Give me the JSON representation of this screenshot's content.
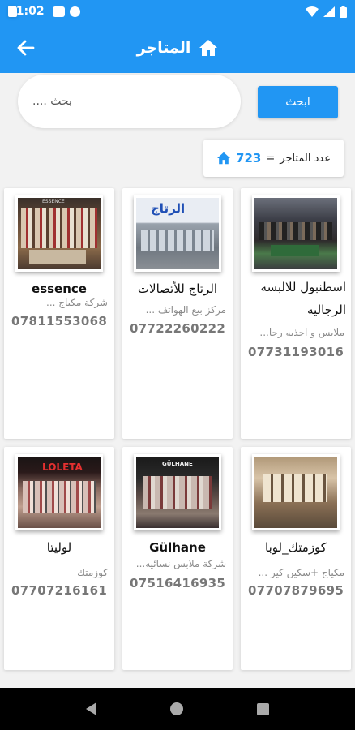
{
  "status_bar": {
    "time": "11:02"
  },
  "app_bar": {
    "title": "المتاجر"
  },
  "search": {
    "placeholder": "بحث ....",
    "button_label": "ابحث"
  },
  "store_count": {
    "label": "عدد المتاجر",
    "equals": "=",
    "value": "723"
  },
  "stores": [
    {
      "name": "اسطنبول للالبسه الرجاليه",
      "description": "ملابس و احذيه رجا...",
      "phone": "07731193016"
    },
    {
      "name": "الرتاج للأتصالات",
      "description": "مركز بيع الهواتف ...",
      "phone": "07722260222"
    },
    {
      "name": "essence",
      "description": "شركة مكياج ...",
      "phone": "07811553068"
    },
    {
      "name": "كوزمتك_لوبا",
      "description": "مكياج +سكين كير ...",
      "phone": "07707879695"
    },
    {
      "name": "Gülhane",
      "description": "شركة ملابس نسائيه...",
      "phone": "07516416935"
    },
    {
      "name": "لوليتا",
      "description": "كوزمتك",
      "phone": "07707216161"
    }
  ],
  "photo_signs": {
    "store_2": "الرتاج",
    "store_3": "ESSENCE",
    "store_5": "GÜLHANE",
    "store_6": "LOLETA"
  }
}
